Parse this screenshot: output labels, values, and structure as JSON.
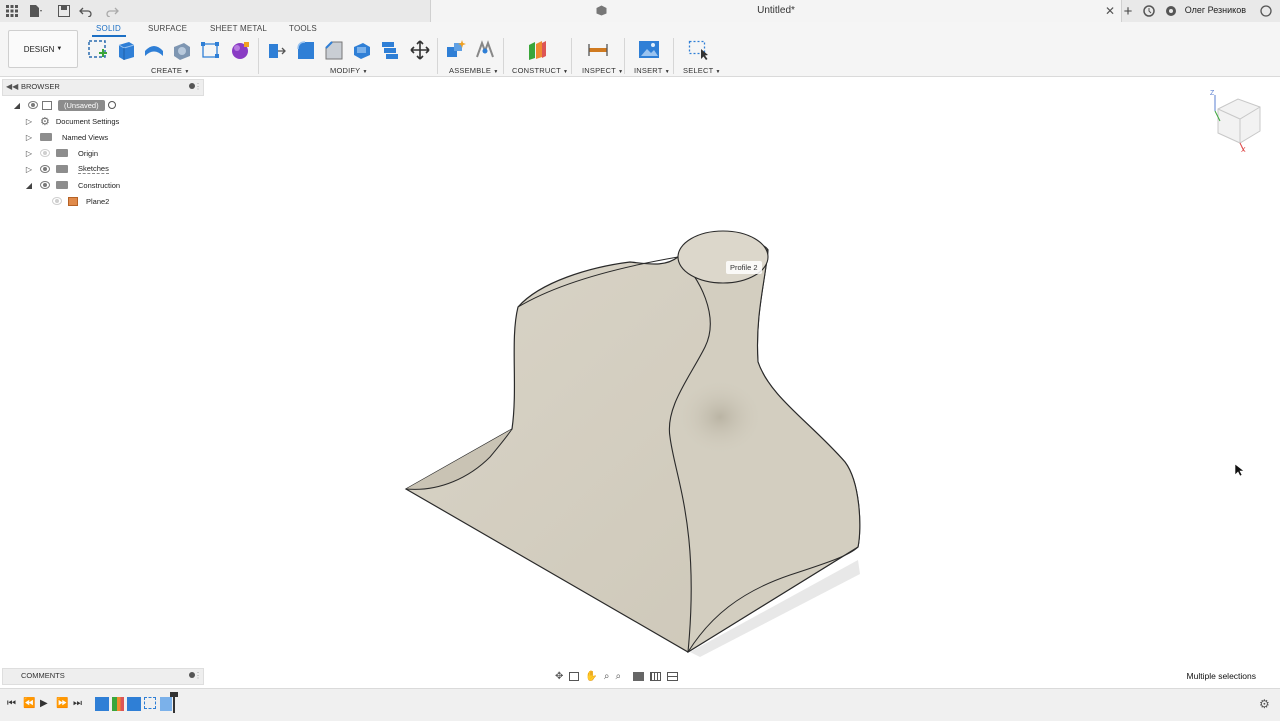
{
  "document": {
    "title": "Untitled*"
  },
  "user": {
    "name": "Олег Резников"
  },
  "workspace": {
    "mode_label": "DESIGN",
    "tabs": [
      {
        "label": "SOLID",
        "active": true
      },
      {
        "label": "SURFACE",
        "active": false
      },
      {
        "label": "SHEET METAL",
        "active": false
      },
      {
        "label": "TOOLS",
        "active": false
      }
    ]
  },
  "toolbar": {
    "groups": [
      "CREATE",
      "MODIFY",
      "ASSEMBLE",
      "CONSTRUCT",
      "INSPECT",
      "INSERT",
      "SELECT"
    ]
  },
  "browser": {
    "title": "BROWSER",
    "root": "(Unsaved)",
    "items": [
      {
        "label": "Document Settings",
        "icon": "gear-icon"
      },
      {
        "label": "Named Views",
        "icon": "folder-icon"
      },
      {
        "label": "Origin",
        "icon": "folder-icon"
      },
      {
        "label": "Sketches",
        "icon": "folder-icon"
      },
      {
        "label": "Construction",
        "icon": "folder-icon"
      },
      {
        "label": "Plane2",
        "icon": "plane-icon"
      }
    ]
  },
  "comments": {
    "title": "COMMENTS"
  },
  "viewport": {
    "profile_label": "Profile 2"
  },
  "status": {
    "text": "Multiple selections"
  },
  "colors": {
    "accent": "#1c6fc4",
    "body": "#d6d1c4",
    "body_shadow": "#bfb9aa"
  }
}
